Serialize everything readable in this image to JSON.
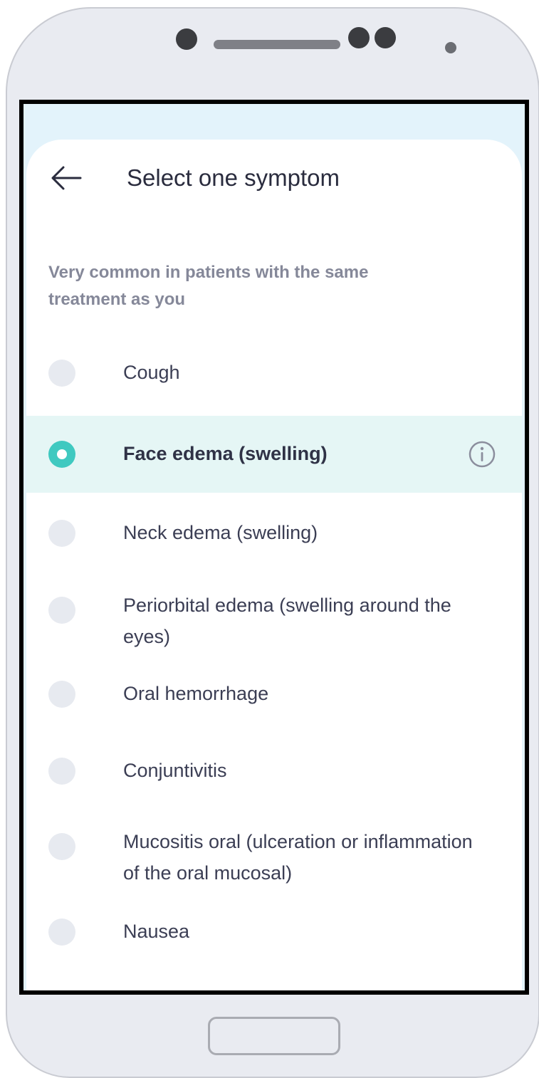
{
  "header": {
    "back_icon": "arrow-left-icon",
    "title": "Select one symptom"
  },
  "section": {
    "label": "Very common in patients with the same treatment as you"
  },
  "options": [
    {
      "label": "Cough",
      "selected": false
    },
    {
      "label": "Face edema (swelling)",
      "selected": true,
      "info_icon": "info-circle-icon"
    },
    {
      "label": "Neck edema  (swelling)",
      "selected": false
    },
    {
      "label": "Periorbital edema  (swelling around the eyes)",
      "selected": false
    },
    {
      "label": "Oral hemorrhage",
      "selected": false
    },
    {
      "label": "Conjuntivitis",
      "selected": false
    },
    {
      "label": "Mucositis oral (ulceration or inflammation of the oral mucosal)",
      "selected": false
    },
    {
      "label": "Nausea",
      "selected": false
    }
  ],
  "colors": {
    "accent": "#3fc9c0",
    "selected_row_bg": "#e5f6f5",
    "screen_top_bg": "#e3f3fb",
    "radio_off": "#e7eaf0",
    "text_primary": "#2a2c3e",
    "text_secondary": "#858899"
  }
}
